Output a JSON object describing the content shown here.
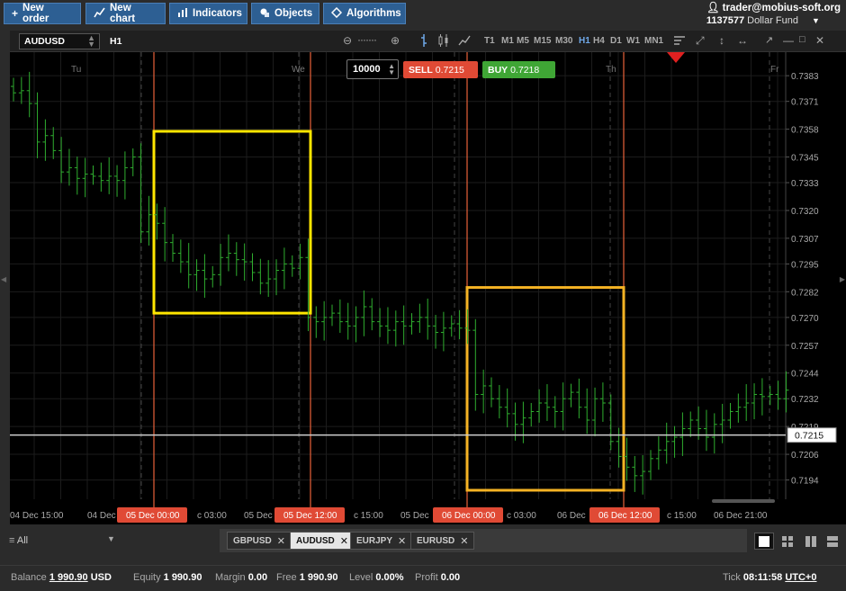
{
  "toolbar": {
    "new_order": "New order",
    "new_chart": "New chart",
    "indicators": "Indicators",
    "objects": "Objects",
    "algorithms": "Algorithms"
  },
  "account": {
    "user": "trader@mobius-soft.org",
    "number": "1137577",
    "fund": "Dollar Fund"
  },
  "chart_header": {
    "symbol": "AUDUSD",
    "timeframe": "H1",
    "timeframes": [
      "T1",
      "M1",
      "M5",
      "M15",
      "M30",
      "H1",
      "H4",
      "D1",
      "W1",
      "MN1"
    ],
    "active_timeframe": "H1"
  },
  "trade": {
    "lot": "10000",
    "sell_label": "SELL",
    "sell_price": "0.7215",
    "buy_label": "BUY",
    "buy_price": "0.7218"
  },
  "chart_data": {
    "type": "ohlc",
    "symbol": "AUDUSD",
    "timeframe": "H1",
    "day_labels": [
      "Tu",
      "We",
      "Th",
      "Fr"
    ],
    "y_ticks": [
      "0.7383",
      "0.7371",
      "0.7358",
      "0.7345",
      "0.7333",
      "0.7320",
      "0.7307",
      "0.7295",
      "0.7282",
      "0.7270",
      "0.7257",
      "0.7244",
      "0.7232",
      "0.7219",
      "0.7206",
      "0.7194"
    ],
    "ylim": [
      0.7185,
      0.7394
    ],
    "current_price": "0.7215",
    "x_labels": [
      "04 Dec 15:00",
      "04 Dec",
      "05 Dec 00:00",
      "c 03:00",
      "05 Dec",
      "05 Dec 12:00",
      "c 15:00",
      "05 Dec",
      "06 Dec 00:00",
      "c 03:00",
      "06 Dec",
      "06 Dec 12:00",
      "c 15:00",
      "06 Dec 21:00"
    ],
    "highlighted_times": [
      "05 Dec 00:00",
      "05 Dec 12:00",
      "06 Dec 00:00",
      "06 Dec 12:00"
    ],
    "highlight_boxes": [
      {
        "from": "05 Dec 00:00",
        "to": "05 Dec 12:00",
        "high": 0.7357,
        "low": 0.7272,
        "color": "#ffe600"
      },
      {
        "from": "06 Dec 00:00",
        "to": "06 Dec 12:00",
        "high": 0.7284,
        "low": 0.7185,
        "color": "#f5b324"
      }
    ],
    "closes": [
      0.7375,
      0.7376,
      0.737,
      0.7352,
      0.7355,
      0.7348,
      0.7338,
      0.734,
      0.7335,
      0.7337,
      0.7336,
      0.7334,
      0.7336,
      0.7334,
      0.734,
      0.7345,
      0.731,
      0.7318,
      0.7314,
      0.7305,
      0.73,
      0.7296,
      0.729,
      0.7292,
      0.7288,
      0.729,
      0.7298,
      0.73,
      0.7297,
      0.7296,
      0.7291,
      0.7286,
      0.7288,
      0.7292,
      0.7295,
      0.7293,
      0.7298,
      0.727,
      0.7268,
      0.727,
      0.7272,
      0.7268,
      0.7266,
      0.727,
      0.7275,
      0.7268,
      0.7266,
      0.7264,
      0.7268,
      0.7266,
      0.7268,
      0.727,
      0.7266,
      0.7263,
      0.7265,
      0.7267,
      0.7265,
      0.7264,
      0.7234,
      0.7238,
      0.7232,
      0.7228,
      0.7225,
      0.722,
      0.7223,
      0.7226,
      0.723,
      0.7228,
      0.7226,
      0.7232,
      0.7235,
      0.7228,
      0.7222,
      0.7232,
      0.723,
      0.7212,
      0.7205,
      0.72,
      0.7196,
      0.7198,
      0.7204,
      0.7208,
      0.7212,
      0.7214,
      0.7218,
      0.7222,
      0.7218,
      0.7214,
      0.722,
      0.7222,
      0.7226,
      0.7228,
      0.723,
      0.7234,
      0.7233,
      0.7234,
      0.7232,
      0.7236
    ]
  },
  "symbol_tabs": [
    "GBPUSD",
    "AUDUSD",
    "EURJPY",
    "EURUSD"
  ],
  "active_tab": "AUDUSD",
  "filter": "All",
  "status": {
    "balance_label": "Balance",
    "balance": "1 990.90",
    "currency": "USD",
    "equity_label": "Equity",
    "equity": "1 990.90",
    "margin_label": "Margin",
    "margin": "0.00",
    "free_label": "Free",
    "free": "1 990.90",
    "level_label": "Level",
    "level": "0.00%",
    "profit_label": "Profit",
    "profit": "0.00",
    "tick_label": "Tick",
    "tick_time": "08:11:58",
    "timezone": "UTC+0"
  },
  "colors": {
    "sell": "#e04a35",
    "buy": "#3fa635",
    "candle": "#2fae2f",
    "marker_line": "#e8623a",
    "accent_blue": "#2d5f93"
  }
}
